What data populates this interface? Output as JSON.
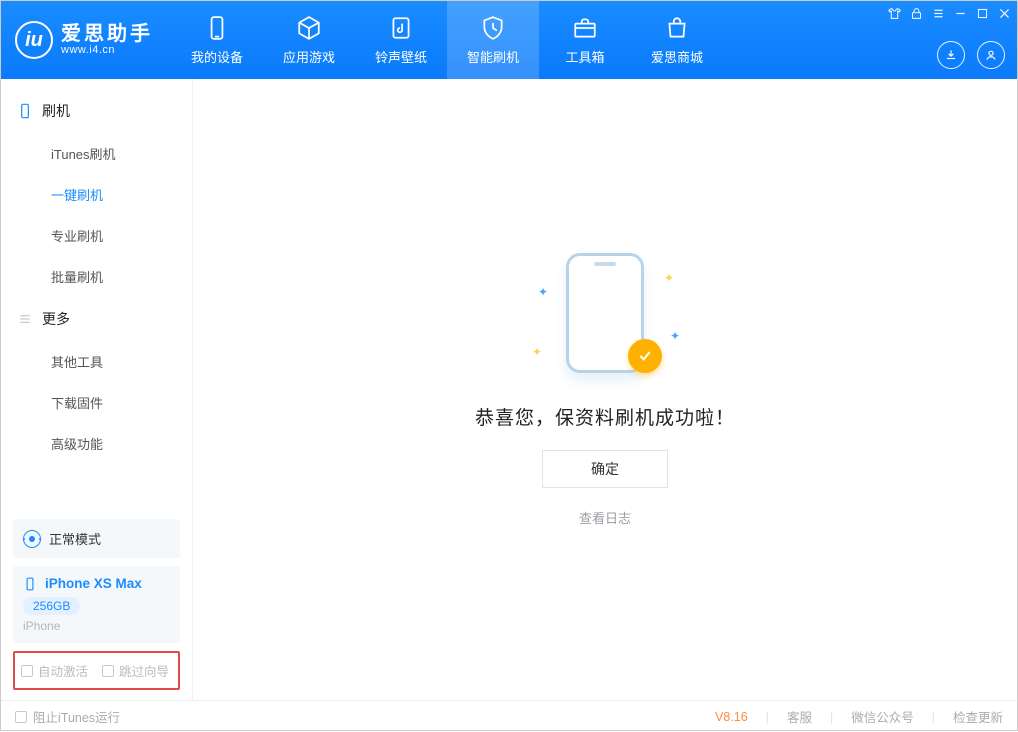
{
  "brand": {
    "title": "爱思助手",
    "url": "www.i4.cn"
  },
  "nav": {
    "items": [
      {
        "label": "我的设备",
        "icon": "device"
      },
      {
        "label": "应用游戏",
        "icon": "cube"
      },
      {
        "label": "铃声壁纸",
        "icon": "music"
      },
      {
        "label": "智能刷机",
        "icon": "shield"
      },
      {
        "label": "工具箱",
        "icon": "toolbox"
      },
      {
        "label": "爱思商城",
        "icon": "store"
      }
    ],
    "active_index": 3
  },
  "sidebar": {
    "groups": [
      {
        "title": "刷机",
        "icon": "flash",
        "items": [
          "iTunes刷机",
          "一键刷机",
          "专业刷机",
          "批量刷机"
        ],
        "active_index": 1
      },
      {
        "title": "更多",
        "icon": "more",
        "items": [
          "其他工具",
          "下载固件",
          "高级功能"
        ],
        "active_index": -1
      }
    ],
    "device": {
      "mode": "正常模式",
      "name": "iPhone XS Max",
      "capacity": "256GB",
      "type": "iPhone"
    },
    "checks": {
      "auto_activate": "自动激活",
      "skip_guide": "跳过向导"
    }
  },
  "main": {
    "success": "恭喜您，保资料刷机成功啦！",
    "ok": "确定",
    "log": "查看日志"
  },
  "footer": {
    "block_itunes": "阻止iTunes运行",
    "version": "V8.16",
    "support": "客服",
    "wechat": "微信公众号",
    "update": "检查更新"
  }
}
